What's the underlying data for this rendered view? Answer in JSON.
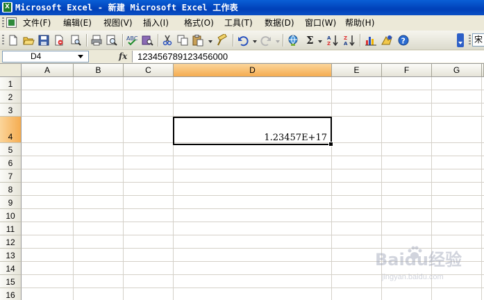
{
  "window": {
    "title": "Microsoft Excel - 新建 Microsoft Excel 工作表"
  },
  "menu": {
    "items": [
      {
        "label": "文件(F)"
      },
      {
        "label": "编辑(E)"
      },
      {
        "label": "视图(V)"
      },
      {
        "label": "插入(I)"
      },
      {
        "label": "格式(O)"
      },
      {
        "label": "工具(T)"
      },
      {
        "label": "数据(D)"
      },
      {
        "label": "窗口(W)"
      },
      {
        "label": "帮助(H)"
      }
    ]
  },
  "toolbar": {
    "font_name": "宋"
  },
  "formula_bar": {
    "name_box": "D4",
    "fx_label": "fx",
    "content": "123456789123456000"
  },
  "sheet": {
    "columns": [
      "A",
      "B",
      "C",
      "D",
      "E",
      "F",
      "G"
    ],
    "rows": [
      "1",
      "2",
      "3",
      "4",
      "5",
      "6",
      "7",
      "8",
      "9",
      "10",
      "11",
      "12",
      "13",
      "14",
      "15",
      "16"
    ],
    "selected_column": "D",
    "selected_row": "4",
    "active_cell": {
      "ref": "D4",
      "display": "1.23457E+17"
    }
  },
  "watermark": {
    "brand": "Baidu经验",
    "url": "jingyan.baidu.com"
  }
}
